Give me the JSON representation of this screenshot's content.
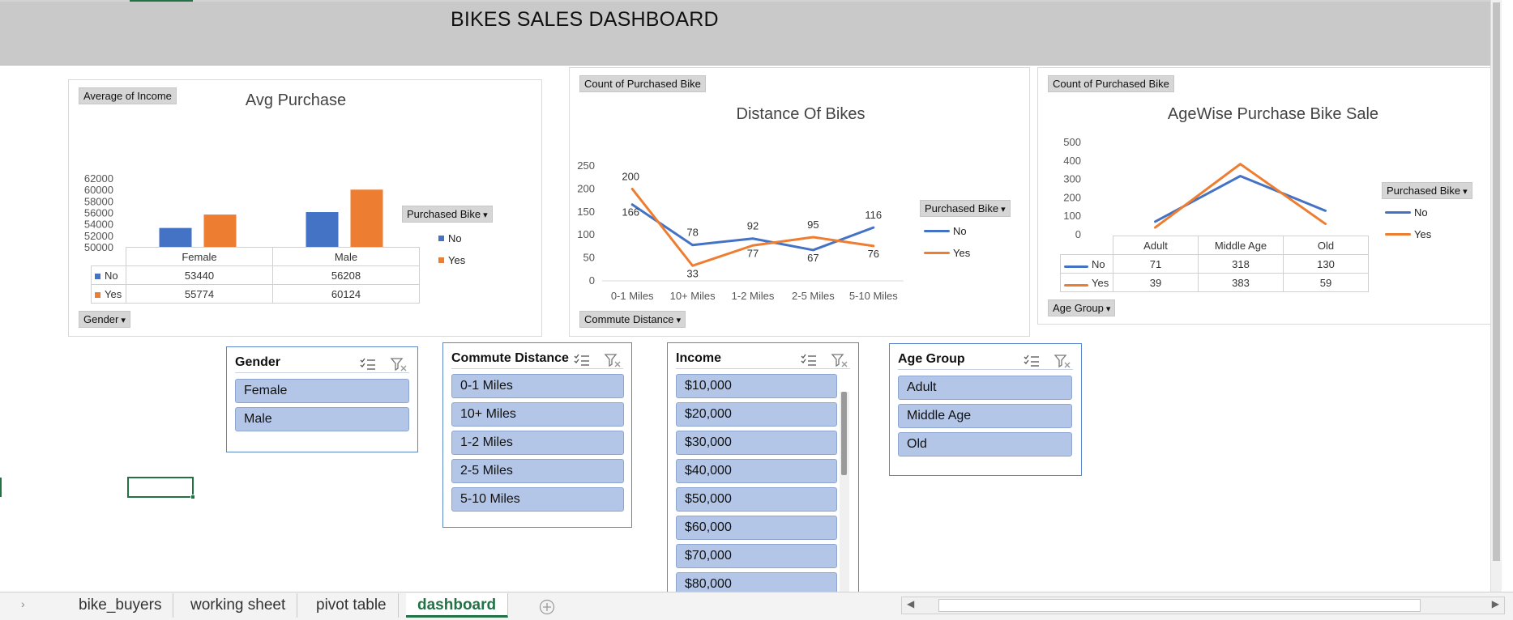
{
  "banner": {
    "title": "BIKES SALES DASHBOARD"
  },
  "colors": {
    "no": "#4472c4",
    "yes": "#ed7d31",
    "slicer_item": "#b4c6e7",
    "excel_green": "#217346"
  },
  "charts": {
    "avg_purchase": {
      "value_button": "Average of Income",
      "axis_button": "Gender",
      "legend_button": "Purchased Bike",
      "legend_no": "No",
      "legend_yes": "Yes"
    },
    "distance": {
      "value_button": "Count of Purchased Bike",
      "axis_button": "Commute Distance",
      "legend_button": "Purchased Bike",
      "legend_no": "No",
      "legend_yes": "Yes"
    },
    "agewise": {
      "value_button": "Count of Purchased Bike",
      "axis_button": "Age Group",
      "legend_button": "Purchased Bike",
      "legend_no": "No",
      "legend_yes": "Yes"
    }
  },
  "chart_data": [
    {
      "type": "bar",
      "title": "Avg Purchase",
      "categories": [
        "Female",
        "Male"
      ],
      "series": [
        {
          "name": "No",
          "values": [
            53440,
            56208
          ]
        },
        {
          "name": "Yes",
          "values": [
            55774,
            60124
          ]
        }
      ],
      "yticks": [
        "62000",
        "60000",
        "58000",
        "56000",
        "54000",
        "52000",
        "50000"
      ],
      "ylim": [
        50000,
        62000
      ],
      "legend": "right",
      "data_table": true
    },
    {
      "type": "line",
      "title": "Distance Of Bikes",
      "categories": [
        "0-1 Miles",
        "10+ Miles",
        "1-2 Miles",
        "2-5 Miles",
        "5-10 Miles"
      ],
      "series": [
        {
          "name": "No",
          "values": [
            166,
            78,
            92,
            67,
            116
          ]
        },
        {
          "name": "Yes",
          "values": [
            200,
            33,
            77,
            95,
            76
          ]
        }
      ],
      "yticks": [
        "250",
        "200",
        "150",
        "100",
        "50",
        "0"
      ],
      "ylim": [
        0,
        250
      ],
      "legend": "right"
    },
    {
      "type": "line",
      "title": "AgeWise Purchase Bike Sale",
      "categories": [
        "Adult",
        "Middle Age",
        "Old"
      ],
      "series": [
        {
          "name": "No",
          "values": [
            71,
            318,
            130
          ]
        },
        {
          "name": "Yes",
          "values": [
            39,
            383,
            59
          ]
        }
      ],
      "yticks": [
        "500",
        "400",
        "300",
        "200",
        "100",
        "0"
      ],
      "ylim": [
        0,
        500
      ],
      "legend": "right",
      "data_table": true
    }
  ],
  "slicers": {
    "gender": {
      "title": "Gender",
      "items": [
        "Female",
        "Male"
      ]
    },
    "commute": {
      "title": "Commute Distance",
      "items": [
        "0-1 Miles",
        "10+ Miles",
        "1-2 Miles",
        "2-5 Miles",
        "5-10 Miles"
      ]
    },
    "income": {
      "title": "Income",
      "items": [
        "$10,000",
        "$20,000",
        "$30,000",
        "$40,000",
        "$50,000",
        "$60,000",
        "$70,000",
        "$80,000"
      ]
    },
    "age": {
      "title": "Age Group",
      "items": [
        "Adult",
        "Middle Age",
        "Old"
      ]
    }
  },
  "tabs": [
    "bike_buyers",
    "working sheet",
    "pivot table",
    "dashboard"
  ],
  "active_tab": "dashboard"
}
